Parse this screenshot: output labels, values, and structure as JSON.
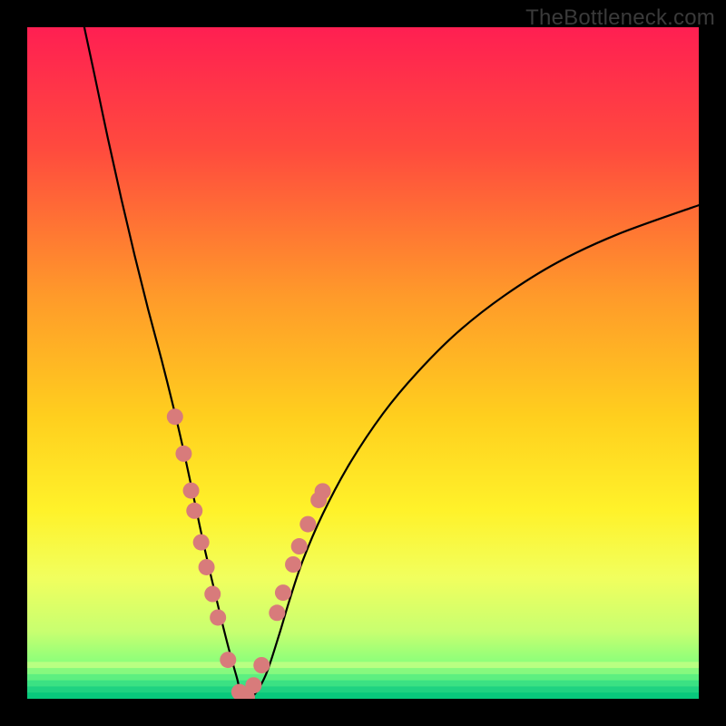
{
  "watermark": "TheBottleneck.com",
  "chart_data": {
    "type": "line",
    "title": "",
    "xlabel": "",
    "ylabel": "",
    "xlim": [
      0,
      100
    ],
    "ylim": [
      0,
      100
    ],
    "grid": false,
    "legend": false,
    "gradient_stops": [
      {
        "offset": 0,
        "color": "#ff1f52"
      },
      {
        "offset": 0.18,
        "color": "#ff4a3e"
      },
      {
        "offset": 0.4,
        "color": "#ff9a2a"
      },
      {
        "offset": 0.58,
        "color": "#ffcf1e"
      },
      {
        "offset": 0.72,
        "color": "#fff22a"
      },
      {
        "offset": 0.82,
        "color": "#f1ff5e"
      },
      {
        "offset": 0.9,
        "color": "#c8ff70"
      },
      {
        "offset": 0.945,
        "color": "#8dff7a"
      },
      {
        "offset": 0.975,
        "color": "#35ef86"
      },
      {
        "offset": 1.0,
        "color": "#08d77e"
      }
    ],
    "green_band": {
      "top_pct": 94.5,
      "bottom_pct": 100
    },
    "series": [
      {
        "name": "bottleneck-curve",
        "stroke": "#000000",
        "stroke_width": 2.2,
        "x": [
          8.5,
          10,
          12,
          14,
          16,
          18,
          20,
          22,
          23.5,
          25,
          26.5,
          28.5,
          30,
          31.2,
          32.0,
          33.5,
          35.5,
          37.5,
          39,
          41,
          44,
          48,
          53,
          58,
          64,
          71,
          79,
          88,
          100
        ],
        "y": [
          100,
          93,
          83.5,
          74.5,
          66,
          58,
          50.5,
          42.5,
          36,
          29,
          22,
          13.5,
          7.5,
          3.2,
          0.4,
          0.3,
          3.5,
          9.5,
          14.5,
          20.5,
          27.5,
          35,
          42.5,
          48.5,
          54.5,
          60,
          65,
          69.2,
          73.5
        ]
      }
    ],
    "points": {
      "name": "highlight-dots",
      "color": "#d87b7b",
      "radius": 9,
      "xy": [
        [
          22.0,
          42.0
        ],
        [
          23.3,
          36.5
        ],
        [
          24.4,
          31.0
        ],
        [
          24.9,
          28.0
        ],
        [
          25.9,
          23.3
        ],
        [
          26.7,
          19.6
        ],
        [
          27.6,
          15.6
        ],
        [
          28.4,
          12.1
        ],
        [
          29.9,
          5.8
        ],
        [
          31.6,
          1.0
        ],
        [
          32.7,
          0.2
        ],
        [
          33.7,
          2.0
        ],
        [
          34.9,
          5.0
        ],
        [
          37.2,
          12.8
        ],
        [
          38.1,
          15.8
        ],
        [
          39.6,
          20.0
        ],
        [
          40.5,
          22.7
        ],
        [
          41.8,
          26.0
        ],
        [
          43.4,
          29.6
        ],
        [
          44.0,
          30.9
        ]
      ]
    }
  }
}
